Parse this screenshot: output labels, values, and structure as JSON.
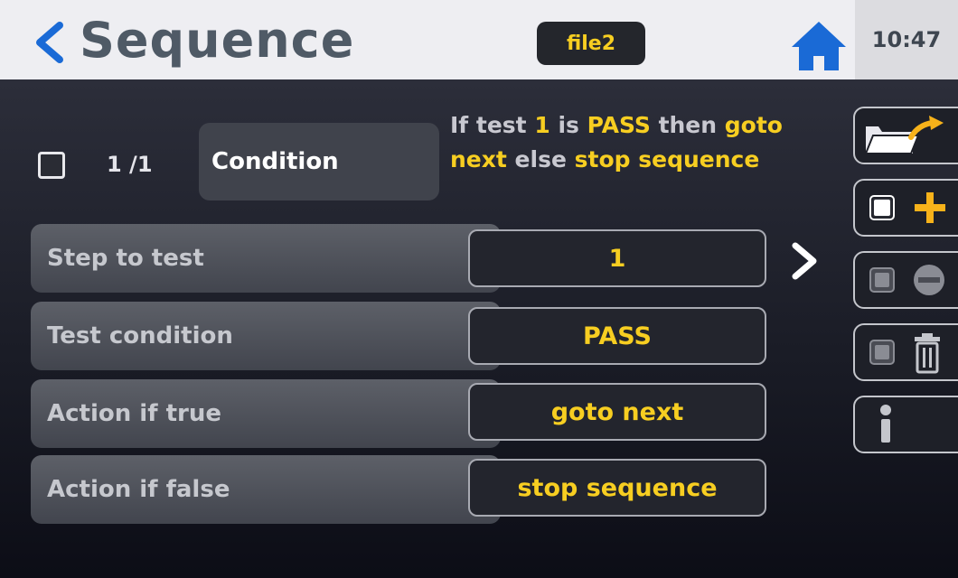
{
  "header": {
    "title": "Sequence",
    "file_badge": "file2",
    "clock": "10:47",
    "back_icon": "chevron-left-icon",
    "home_icon": "home-icon"
  },
  "step": {
    "counter": "1 /1",
    "type_label": "Condition",
    "summary": {
      "p1": "If test ",
      "test_num": "1",
      "p2": " is ",
      "result": "PASS",
      "p3": " then ",
      "action_true": "goto next",
      "p4": " else ",
      "action_false": "stop sequence"
    }
  },
  "params": [
    {
      "label": "Step to test",
      "value": "1"
    },
    {
      "label": "Test condition",
      "value": "PASS"
    },
    {
      "label": "Action if true",
      "value": "goto next"
    },
    {
      "label": "Action if false",
      "value": "stop sequence"
    }
  ],
  "side_buttons": [
    "folder-export-icon",
    "add-step-icon",
    "remove-step-icon",
    "delete-icon",
    "info-icon"
  ],
  "colors": {
    "accent": "#f7ce21",
    "header_bg": "#eeeef2",
    "title": "#4f5a66",
    "icon_blue": "#1a6ad6",
    "plus_orange": "#f7b21a"
  }
}
